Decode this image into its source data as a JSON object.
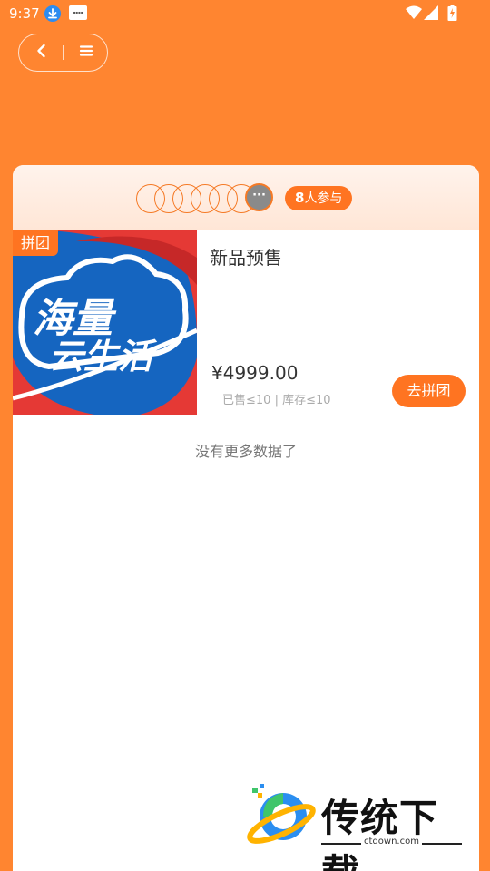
{
  "status_bar": {
    "time": "9:37",
    "icons": [
      "download-icon",
      "news-app-icon",
      "wifi-icon",
      "signal-icon",
      "battery-charging-icon"
    ]
  },
  "nav": {
    "back_icon": "chevron-left-icon",
    "menu_icon": "hamburger-menu-icon"
  },
  "group": {
    "participants_count": "8",
    "participants_suffix": "人参与",
    "more_label": "···"
  },
  "product": {
    "tag": "拼团",
    "title": "新品预售",
    "price": "¥4999.00",
    "sold_stock": "已售≤10 | 库存≤10",
    "join_label": "去拼团",
    "image_text_line1": "海量",
    "image_text_line2": "云生活"
  },
  "list": {
    "no_more": "没有更多数据了"
  },
  "watermark": {
    "title": "传统下载",
    "url": "ctdown.com"
  },
  "colors": {
    "accent": "#ff7421",
    "background": "#ff8530",
    "image_blue": "#1565c0",
    "image_red": "#e53935"
  }
}
